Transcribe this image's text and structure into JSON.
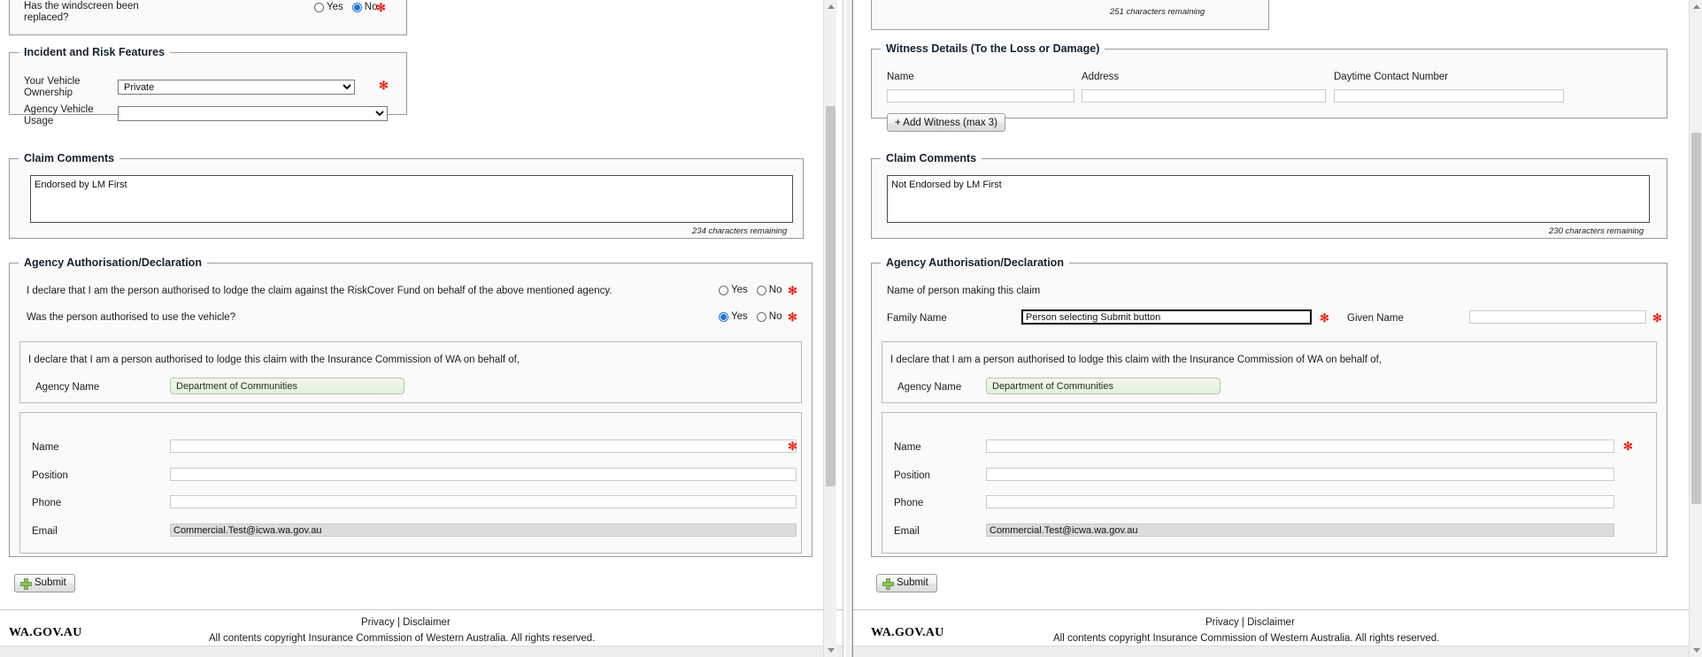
{
  "left_panel": {
    "windscreen": {
      "question": "Has the windscreen been replaced?",
      "option_yes": "Yes",
      "option_no": "No",
      "selected": "No",
      "required_marker": "✻"
    },
    "incident_risk": {
      "legend": "Incident and Risk Features",
      "vehicle_ownership_label": "Your Vehicle Ownership",
      "vehicle_ownership_value": "Private",
      "agency_vehicle_usage_label": "Agency Vehicle Usage",
      "agency_vehicle_usage_value": "",
      "required_marker": "✻"
    },
    "claim_comments": {
      "legend": "Claim Comments",
      "value": "Endorsed by LM First",
      "characters_remaining": "234  characters remaining"
    },
    "agency_declaration": {
      "legend": "Agency Authorisation/Declaration",
      "declaration_text": "I declare that I am the person authorised to lodge the claim against the RiskCover Fund on behalf of the above mentioned agency.",
      "authorised_question": "Was the person authorised to use the vehicle?",
      "option_yes": "Yes",
      "option_no": "No",
      "declaration_selected": "",
      "authorised_selected": "Yes",
      "required_marker": "✻",
      "ica_declaration_text": "I declare that I am a person authorised to lodge this claim with the Insurance Commission of WA on behalf of,",
      "agency_name_label": "Agency Name",
      "agency_name_value": "Department of Communities",
      "name_label": "Name",
      "name_value": "",
      "position_label": "Position",
      "position_value": "",
      "phone_label": "Phone",
      "phone_value": "",
      "email_label": "Email",
      "email_value": "Commercial.Test@icwa.wa.gov.au"
    },
    "submit_label": "Submit",
    "footer": {
      "brand": "WA.GOV.AU",
      "privacy": "Privacy",
      "separator": "|",
      "disclaimer": "Disclaimer",
      "copyright": "All contents copyright Insurance Commission of Western Australia. All rights reserved."
    }
  },
  "right_panel": {
    "top_textarea": {
      "characters_remaining": "251  characters remaining"
    },
    "witness_details": {
      "legend": "Witness Details (To the Loss or Damage)",
      "col_name": "Name",
      "col_address": "Address",
      "col_daytime": "Daytime Contact Number",
      "name_value": "",
      "address_value": "",
      "daytime_value": "",
      "add_witness_label": "+ Add Witness (max 3)"
    },
    "claim_comments": {
      "legend": "Claim Comments",
      "value": "Not Endorsed by LM First",
      "characters_remaining": "230  characters remaining"
    },
    "agency_declaration": {
      "legend": "Agency Authorisation/Declaration",
      "name_of_person_text": "Name of person making this claim",
      "family_name_label": "Family Name",
      "family_name_value": "Person selecting Submit button",
      "given_name_label": "Given Name",
      "given_name_value": "",
      "required_marker": "✻",
      "ica_declaration_text": "I declare that I am a person authorised to lodge this claim with the Insurance Commission of WA on behalf of,",
      "agency_name_label": "Agency Name",
      "agency_name_value": "Department of Communities",
      "name_label": "Name",
      "name_value": "",
      "position_label": "Position",
      "position_value": "",
      "phone_label": "Phone",
      "phone_value": "",
      "email_label": "Email",
      "email_value": "Commercial.Test@icwa.wa.gov.au"
    },
    "submit_label": "Submit",
    "footer": {
      "brand": "WA.GOV.AU",
      "privacy": "Privacy",
      "separator": "|",
      "disclaimer": "Disclaimer",
      "copyright": "All contents copyright Insurance Commission of Western Australia. All rights reserved."
    }
  }
}
